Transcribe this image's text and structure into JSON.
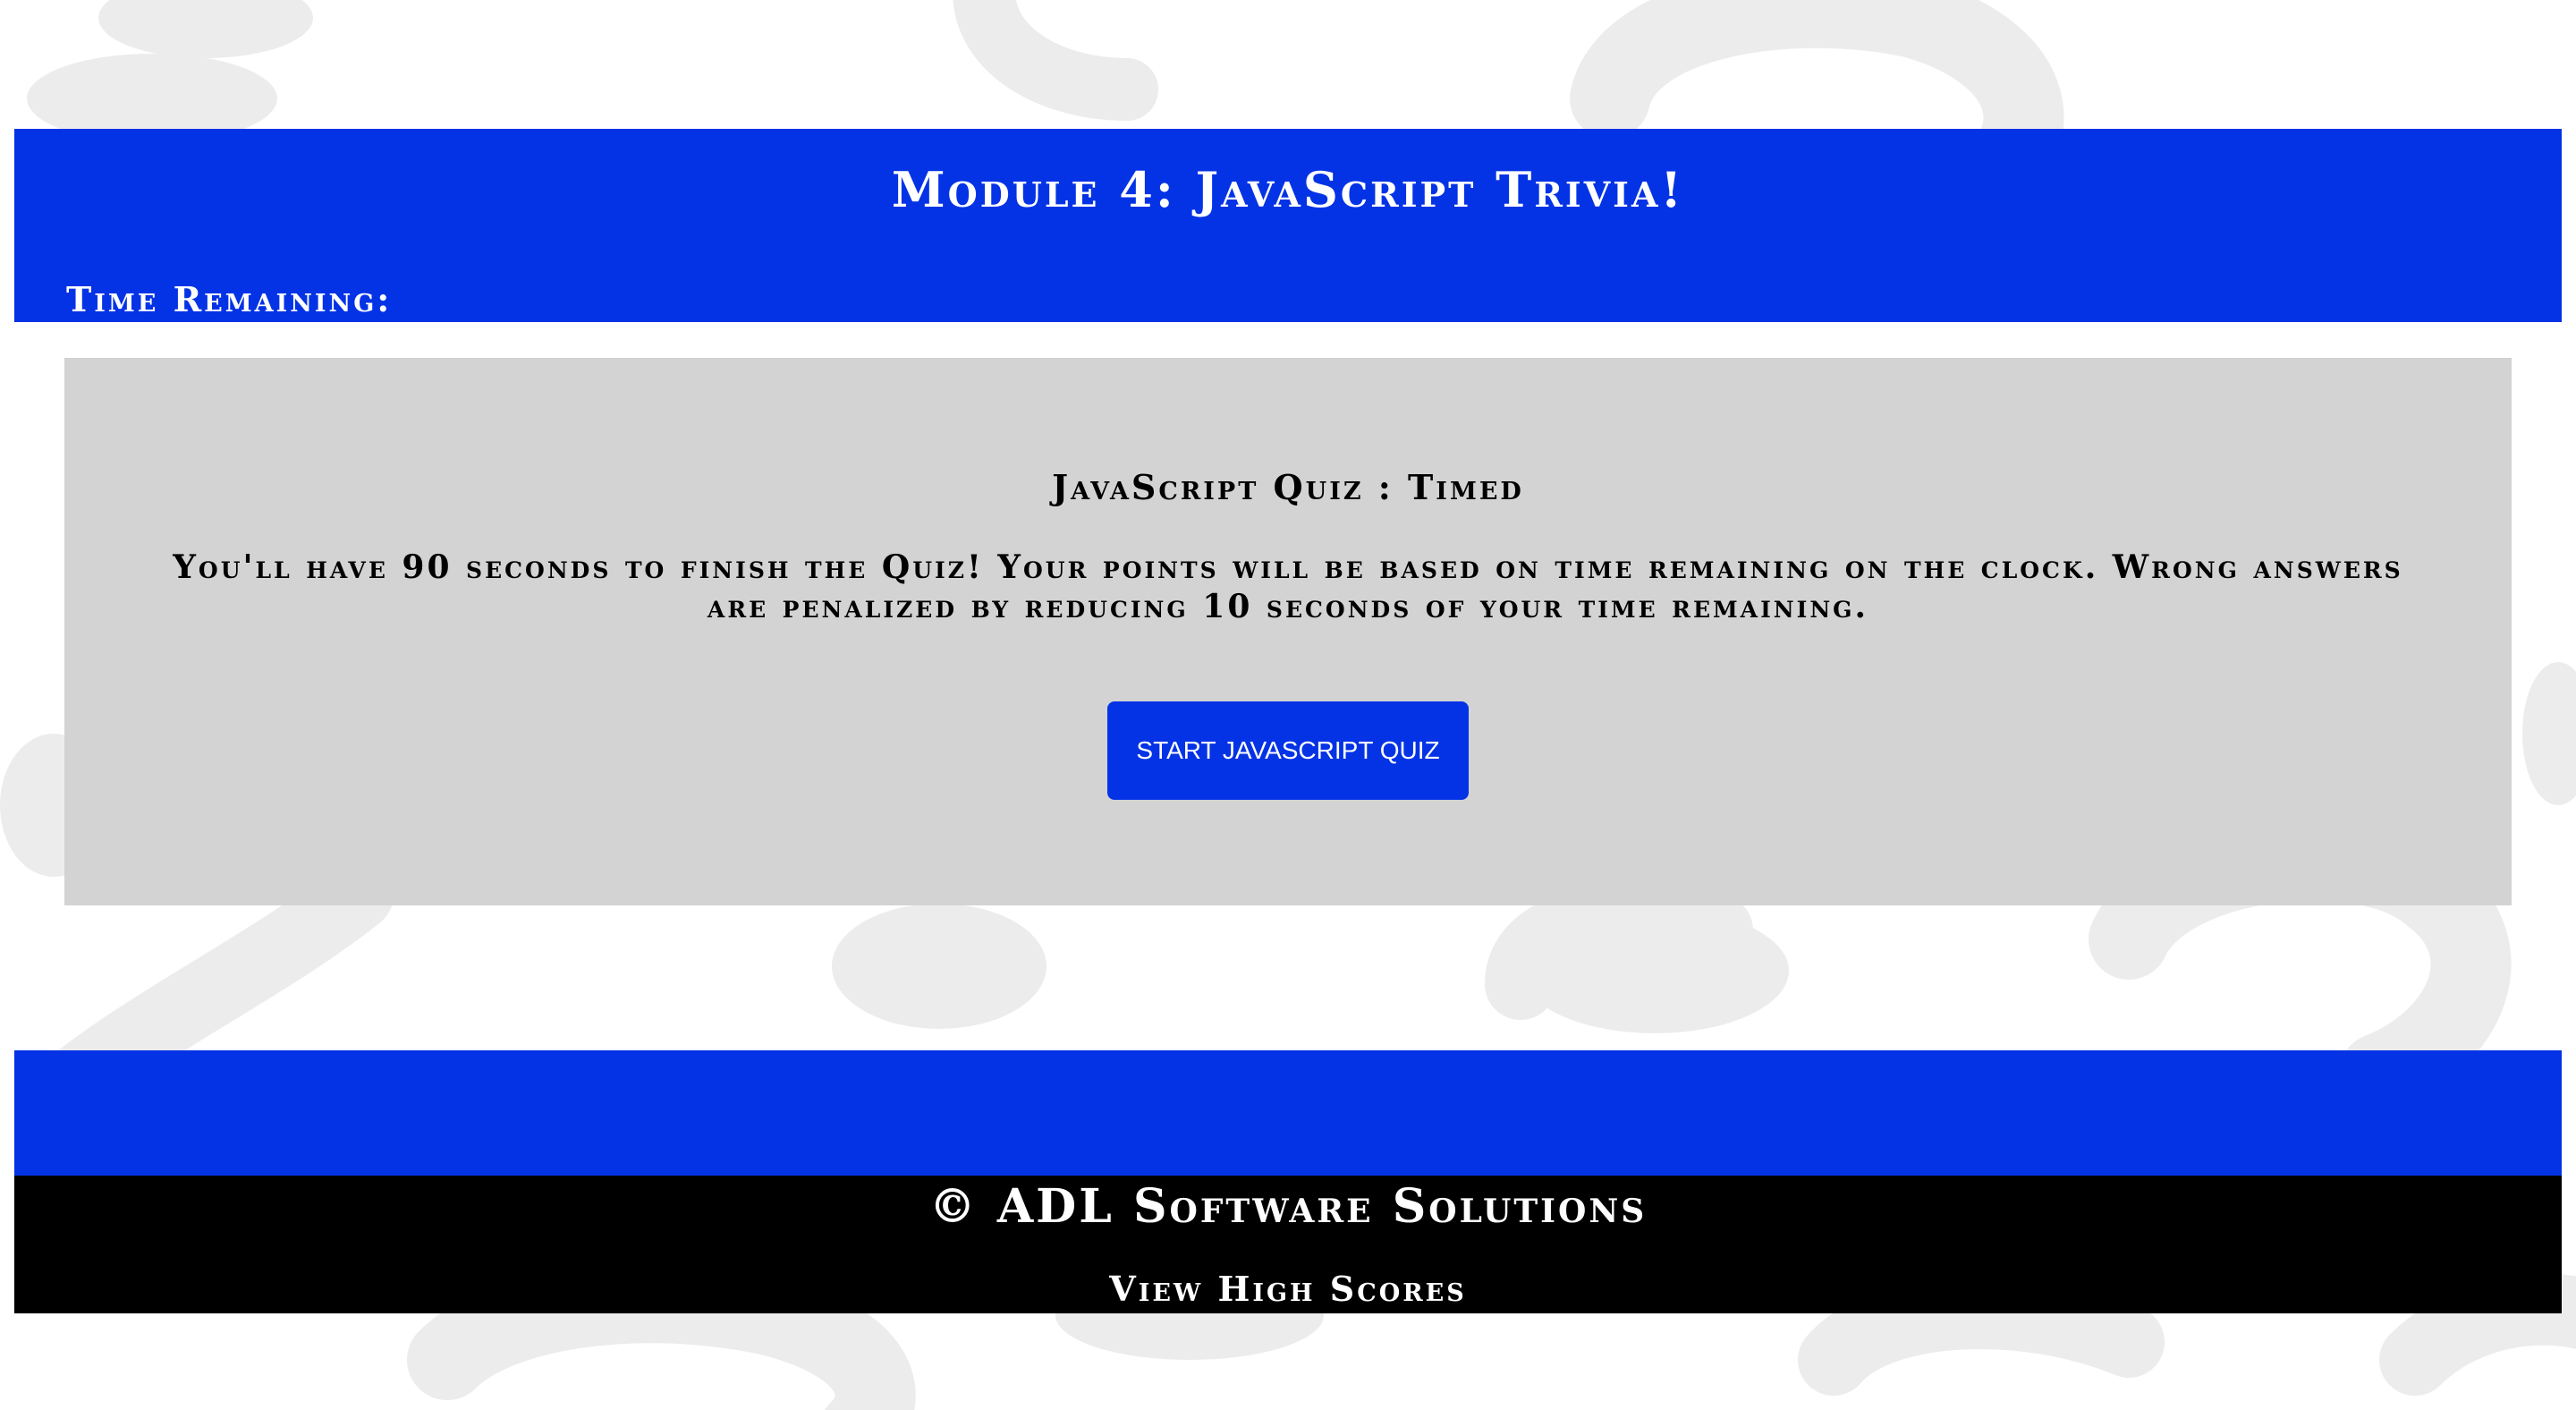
{
  "header": {
    "title": "Module 4: JavaScript Trivia!",
    "timer_label": "Time Remaining:",
    "timer_value": ""
  },
  "intro": {
    "heading": "JavaScript Quiz : Timed",
    "description": "You'll have 90 seconds to finish the Quiz! Your points will be based on time remaining on the clock. Wrong answers are penalized by reducing 10 seconds of your time remaining.",
    "start_button_label": "START JAVASCRIPT QUIZ"
  },
  "footer": {
    "copyright": "© ADL Software Solutions",
    "high_scores_link": "View High Scores"
  },
  "colors": {
    "brand_blue": "#0433e6",
    "card_gray": "#d3d3d3",
    "footer_black": "#000000",
    "text_white": "#ffffff"
  },
  "icons": {
    "background_pattern": "question-mark-icon"
  }
}
